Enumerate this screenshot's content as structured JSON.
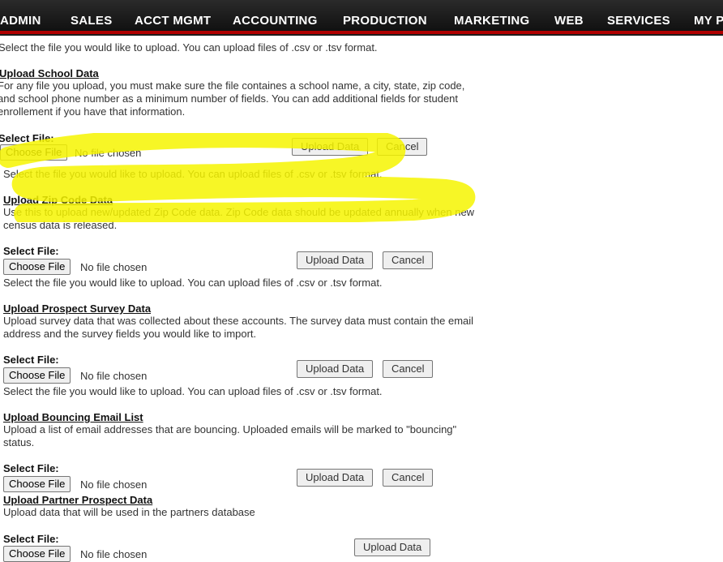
{
  "nav": {
    "items": [
      "ADMIN",
      "SALES",
      "ACCT MGMT",
      "ACCOUNTING",
      "PRODUCTION",
      "MARKETING",
      "WEB",
      "SERVICES",
      "MY P"
    ]
  },
  "top_hint": "Select the file you would like to upload. You can upload files of .csv or .tsv format.",
  "common": {
    "select_label": "Select File:",
    "choose_label": "Choose File",
    "no_file": "No file chosen",
    "upload_label": "Upload Data",
    "cancel_label": "Cancel",
    "hint": "Select the file you would like to upload. You can upload files of .csv or .tsv format."
  },
  "sections": [
    {
      "title": "Upload School Data",
      "description": "For any file you upload, you must make sure the file containes a school name, a city, state, zip code, and school phone number as a minimum number of fields. You can add additional fields for student enrollement if you have that information."
    },
    {
      "title": "Upload Zip Code Data",
      "description": "Use this to upload new/updated Zip Code data. Zip Code data should be updated annually when new census data is released."
    },
    {
      "title": "Upload Prospect Survey Data",
      "description": "Upload survey data that was collected about these accounts. The survey data must contain the email address and the survey fields you would like to import."
    },
    {
      "title": "Upload Bouncing Email List",
      "description": "Upload a list of email addresses that are bouncing. Uploaded emails will be marked to \"bouncing\" status."
    },
    {
      "title": "Upload Partner Prospect Data",
      "description": "Upload data that will be used in the partners database"
    }
  ],
  "colors": {
    "nav_bg": "#1c1c1c",
    "nav_accent": "#b00000",
    "highlight": "#f6f500"
  }
}
